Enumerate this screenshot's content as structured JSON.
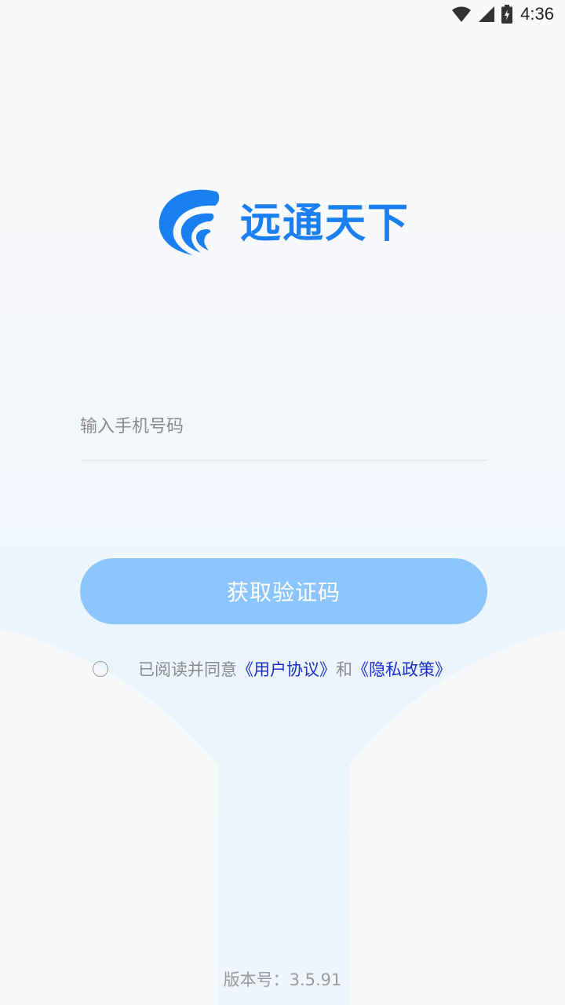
{
  "status_bar": {
    "time": "4:36",
    "icons": [
      "wifi-icon",
      "cell-signal-icon",
      "battery-charging-icon"
    ]
  },
  "brand": {
    "name": "远通天下",
    "logo_icon": "swirl-logo-icon",
    "color": "#1a7ff0"
  },
  "login": {
    "phone_placeholder": "输入手机号码",
    "phone_value": "",
    "get_code_label": "获取验证码",
    "button_color": "#8cc5fb"
  },
  "agreement": {
    "checked": false,
    "prefix": "已阅读并同意",
    "user_agreement": "《用户协议》",
    "conjunction": "和",
    "privacy_policy": "《隐私政策》",
    "link_color": "#1a2fc8"
  },
  "footer": {
    "version": "版本号：3.5.91"
  }
}
